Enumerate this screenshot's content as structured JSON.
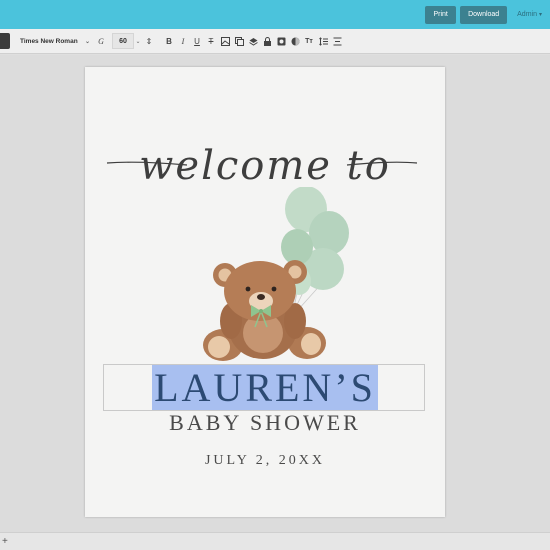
{
  "topbar": {
    "print_label": "Print",
    "download_label": "Download",
    "user_label": "Admin"
  },
  "toolbar": {
    "font_family": "Times New Roman",
    "font_size": "60",
    "icons": [
      "font-icon",
      "line-height-icon",
      "bold-icon",
      "italic-icon",
      "underline-icon",
      "strikethrough-icon",
      "image-icon",
      "duplicate-icon",
      "layers-icon",
      "lock-icon",
      "mask-icon",
      "color-icon",
      "text-transform-icon",
      "spacing-icon",
      "align-icon"
    ]
  },
  "document": {
    "script_heading": "welcome to",
    "name": "LAUREN’S",
    "subtitle": "BABY SHOWER",
    "date": "JULY 2, 20XX"
  },
  "colors": {
    "topbar": "#4bc3dc",
    "button": "#3c8190",
    "name_text": "#2c4a73",
    "selection_highlight": "#a8bff0",
    "balloon": "#b9d6c2",
    "bear": "#b07a54"
  },
  "bottombar": {
    "zoom_symbol": "+"
  }
}
